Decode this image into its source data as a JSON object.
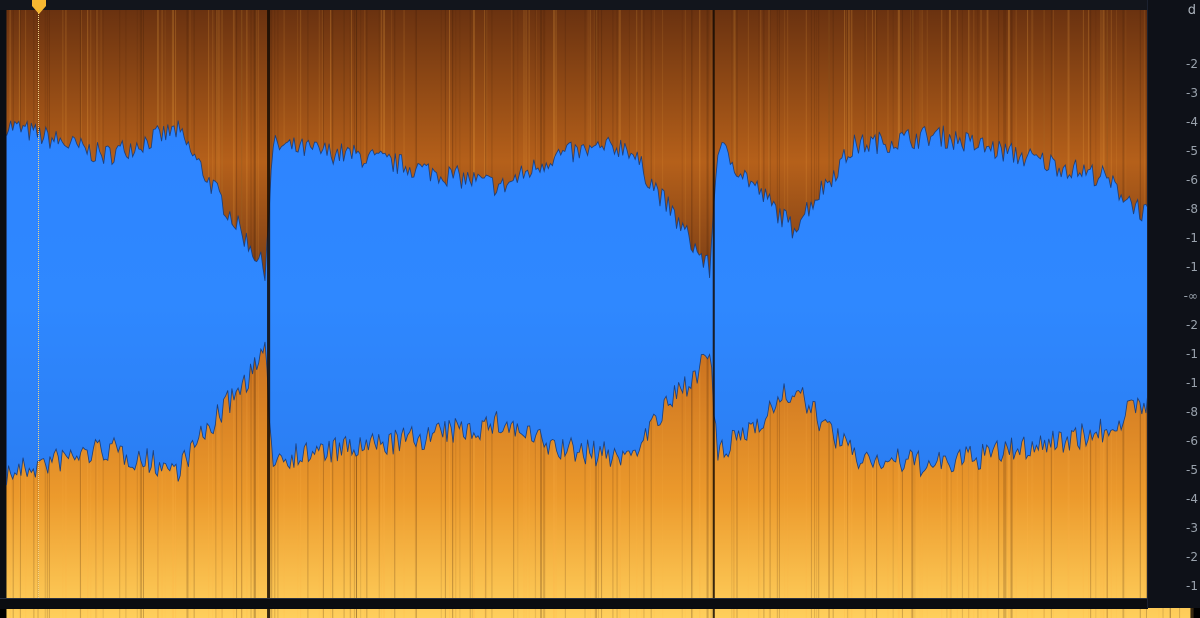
{
  "editor": {
    "mode": "spectrogram-waveform-overlay",
    "colors": {
      "waveform": "#2f86ff",
      "spectrogram_low": "#7a3a10",
      "spectrogram_mid": "#e0801e",
      "spectrogram_high": "#ffd060",
      "background": "#0b0e14",
      "playhead": "#f5b731"
    }
  },
  "ruler": {
    "unit": "d",
    "labels": [
      "-2",
      "-3",
      "-4",
      "-5",
      "-6",
      "-8",
      "-1",
      "-1",
      "-∞",
      "-2",
      "-1",
      "-1",
      "-8",
      "-6",
      "-5",
      "-4",
      "-3",
      "-2",
      "-1"
    ]
  },
  "playhead": {
    "label": "playhead"
  }
}
